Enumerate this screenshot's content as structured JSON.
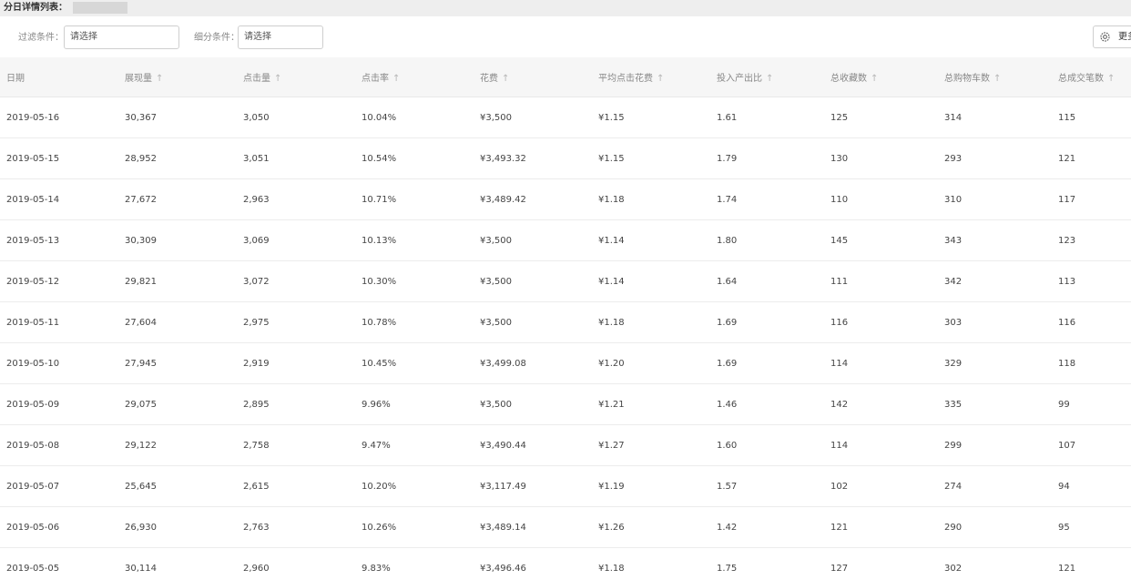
{
  "header": {
    "title": "分日详情列表："
  },
  "filters": {
    "filter_label": "过滤条件：",
    "filter_placeholder": "请选择",
    "subdivide_label": "细分条件：",
    "subdivide_placeholder": "请选择"
  },
  "toolbar": {
    "more_label": "更多",
    "more_icon": "gear-icon"
  },
  "table": {
    "columns": [
      {
        "label": "日期",
        "sortable": false
      },
      {
        "label": "展现量",
        "sortable": true
      },
      {
        "label": "点击量",
        "sortable": true
      },
      {
        "label": "点击率",
        "sortable": true
      },
      {
        "label": "花费",
        "sortable": true
      },
      {
        "label": "平均点击花费",
        "sortable": true
      },
      {
        "label": "投入产出比",
        "sortable": true
      },
      {
        "label": "总收藏数",
        "sortable": true
      },
      {
        "label": "总购物车数",
        "sortable": true
      },
      {
        "label": "总成交笔数",
        "sortable": true
      }
    ],
    "sort_glyph": "↑",
    "rows": [
      [
        "2019-05-16",
        "30,367",
        "3,050",
        "10.04%",
        "¥3,500",
        "¥1.15",
        "1.61",
        "125",
        "314",
        "115"
      ],
      [
        "2019-05-15",
        "28,952",
        "3,051",
        "10.54%",
        "¥3,493.32",
        "¥1.15",
        "1.79",
        "130",
        "293",
        "121"
      ],
      [
        "2019-05-14",
        "27,672",
        "2,963",
        "10.71%",
        "¥3,489.42",
        "¥1.18",
        "1.74",
        "110",
        "310",
        "117"
      ],
      [
        "2019-05-13",
        "30,309",
        "3,069",
        "10.13%",
        "¥3,500",
        "¥1.14",
        "1.80",
        "145",
        "343",
        "123"
      ],
      [
        "2019-05-12",
        "29,821",
        "3,072",
        "10.30%",
        "¥3,500",
        "¥1.14",
        "1.64",
        "111",
        "342",
        "113"
      ],
      [
        "2019-05-11",
        "27,604",
        "2,975",
        "10.78%",
        "¥3,500",
        "¥1.18",
        "1.69",
        "116",
        "303",
        "116"
      ],
      [
        "2019-05-10",
        "27,945",
        "2,919",
        "10.45%",
        "¥3,499.08",
        "¥1.20",
        "1.69",
        "114",
        "329",
        "118"
      ],
      [
        "2019-05-09",
        "29,075",
        "2,895",
        "9.96%",
        "¥3,500",
        "¥1.21",
        "1.46",
        "142",
        "335",
        "99"
      ],
      [
        "2019-05-08",
        "29,122",
        "2,758",
        "9.47%",
        "¥3,490.44",
        "¥1.27",
        "1.60",
        "114",
        "299",
        "107"
      ],
      [
        "2019-05-07",
        "25,645",
        "2,615",
        "10.20%",
        "¥3,117.49",
        "¥1.19",
        "1.57",
        "102",
        "274",
        "94"
      ],
      [
        "2019-05-06",
        "26,930",
        "2,763",
        "10.26%",
        "¥3,489.14",
        "¥1.26",
        "1.42",
        "121",
        "290",
        "95"
      ],
      [
        "2019-05-05",
        "30,114",
        "2,960",
        "9.83%",
        "¥3,496.46",
        "¥1.18",
        "1.75",
        "127",
        "302",
        "121"
      ]
    ]
  }
}
